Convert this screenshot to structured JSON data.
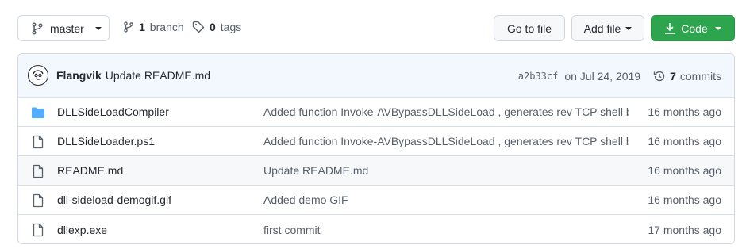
{
  "toolbar": {
    "branch_button": "master",
    "branch_count": "1",
    "branch_label": "branch",
    "tag_count": "0",
    "tag_label": "tags",
    "go_to_file": "Go to file",
    "add_file": "Add file",
    "code": "Code"
  },
  "latest_commit": {
    "author": "Flangvik",
    "message": "Update README.md",
    "sha": "a2b33cf",
    "date": "on Jul 24, 2019",
    "commit_count": "7",
    "commit_label": "commits"
  },
  "files": [
    {
      "type": "folder",
      "name": "DLLSideLoadCompiler",
      "message": "Added function Invoke-AVBypassDLLSideLoad , generates rev TCP shell b...",
      "age": "16 months ago"
    },
    {
      "type": "file",
      "name": "DLLSideLoader.ps1",
      "message": "Added function Invoke-AVBypassDLLSideLoad , generates rev TCP shell b...",
      "age": "16 months ago"
    },
    {
      "type": "file",
      "name": "README.md",
      "message": "Update README.md",
      "age": "16 months ago"
    },
    {
      "type": "file",
      "name": "dll-sideload-demogif.gif",
      "message": "Added demo GIF",
      "age": "16 months ago"
    },
    {
      "type": "file",
      "name": "dllexp.exe",
      "message": "first commit",
      "age": "17 months ago"
    }
  ],
  "colors": {
    "code_button": "#2da44e",
    "folder_icon": "#54aeff",
    "header_bg": "#f3f8ff"
  }
}
